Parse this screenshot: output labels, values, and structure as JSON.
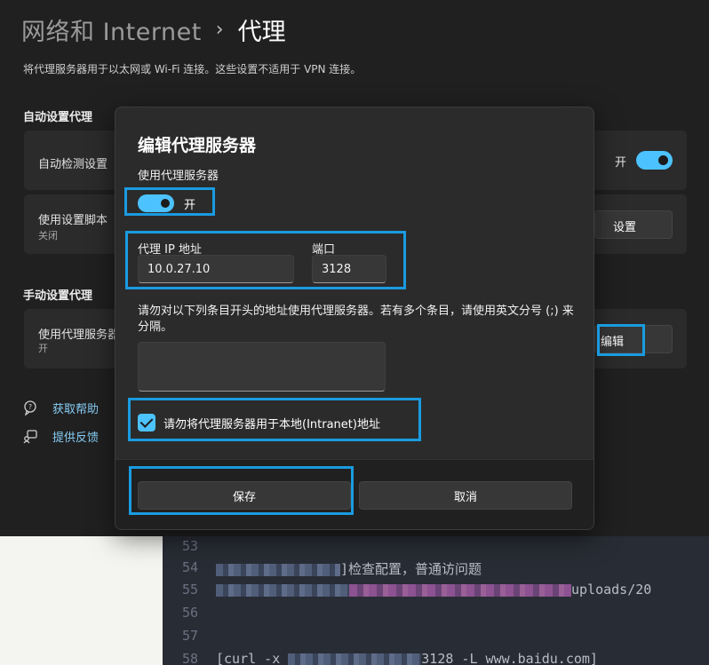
{
  "header": {
    "breadcrumb_parent": "网络和 Internet",
    "separator": "›",
    "title": "代理",
    "description": "将代理服务器用于以太网或 Wi-Fi 连接。这些设置不适用于 VPN 连接。"
  },
  "auto_proxy": {
    "section_title": "自动设置代理",
    "auto_detect_label": "自动检测设置",
    "auto_detect_state": "开",
    "script_label": "使用设置脚本",
    "script_state": "关闭",
    "script_button": "设置"
  },
  "manual_proxy": {
    "section_title": "手动设置代理",
    "use_proxy_label": "使用代理服务器",
    "use_proxy_state": "开",
    "edit_button": "编辑"
  },
  "links": {
    "help": "获取帮助",
    "feedback": "提供反馈"
  },
  "dialog": {
    "title": "编辑代理服务器",
    "use_proxy_label": "使用代理服务器",
    "toggle_state": "开",
    "ip_label": "代理 IP 地址",
    "ip_value": "10.0.27.10",
    "port_label": "端口",
    "port_value": "3128",
    "exceptions_hint": "请勿对以下列条目开头的地址使用代理服务器。若有多个条目，请使用英文分号 (;) 来分隔。",
    "exceptions_value": "",
    "bypass_local_label": "请勿将代理服务器用于本地(Intranet)地址",
    "bypass_local_checked": true,
    "save_button": "保存",
    "cancel_button": "取消"
  },
  "editor": {
    "lines": [
      {
        "num": "53",
        "pre": "",
        "post": ""
      },
      {
        "num": "54",
        "pre": "",
        "post": "]检查配置，普通访问题"
      },
      {
        "num": "55",
        "pre": "",
        "post": "uploads/20"
      },
      {
        "num": "56",
        "pre": "",
        "post": ""
      },
      {
        "num": "57",
        "pre": "",
        "post": ""
      },
      {
        "num": "58",
        "pre": "[curl -x ",
        "post": "3128 -L www.baidu.com]"
      }
    ]
  },
  "colors": {
    "accent": "#4cc2ff",
    "highlight_frame": "#1a9be0",
    "dialog_bg": "#2b2b2b",
    "page_bg": "#202020"
  }
}
